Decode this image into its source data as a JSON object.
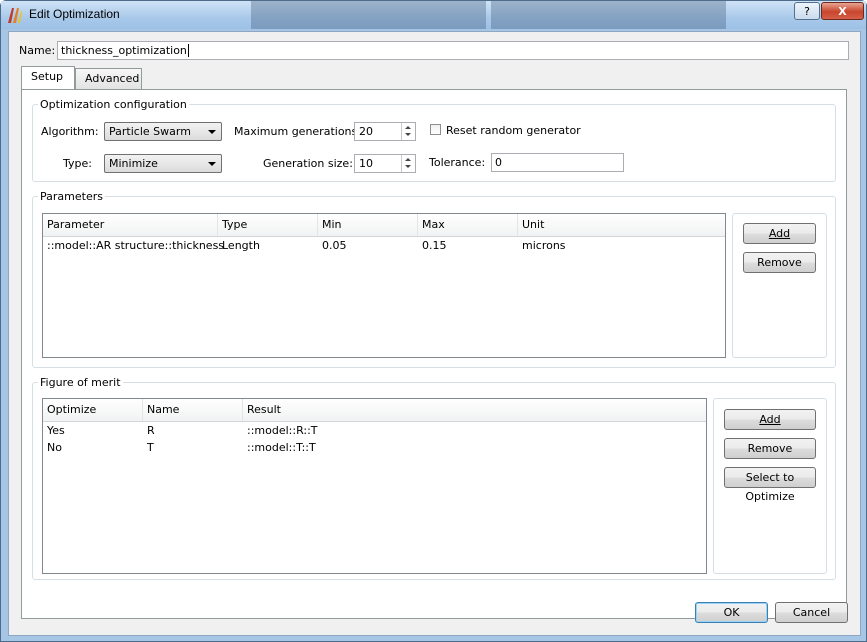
{
  "window": {
    "title": "Edit Optimization",
    "help_label": "?",
    "close_label": "X"
  },
  "name_field": {
    "label": "Name:",
    "value": "thickness_optimization"
  },
  "tabs": [
    {
      "label": "Setup"
    },
    {
      "label": "Advanced"
    }
  ],
  "optimization_config": {
    "title": "Optimization configuration",
    "algorithm_label": "Algorithm:",
    "algorithm_value": "Particle Swarm",
    "type_label": "Type:",
    "type_value": "Minimize",
    "max_generations_label": "Maximum generations:",
    "max_generations_value": "20",
    "generation_size_label": "Generation size:",
    "generation_size_value": "10",
    "reset_random_label": "Reset random generator",
    "tolerance_label": "Tolerance:",
    "tolerance_value": "0"
  },
  "parameters": {
    "title": "Parameters",
    "columns": [
      "Parameter",
      "Type",
      "Min",
      "Max",
      "Unit"
    ],
    "rows": [
      [
        "::model::AR structure::thickness",
        "Length",
        "0.05",
        "0.15",
        "microns"
      ]
    ],
    "add_label": "Add",
    "remove_label": "Remove"
  },
  "figure_of_merit": {
    "title": "Figure of merit",
    "columns": [
      "Optimize",
      "Name",
      "Result"
    ],
    "rows": [
      [
        "Yes",
        "R",
        "::model::R::T"
      ],
      [
        "No",
        "T",
        "::model::T::T"
      ]
    ],
    "add_label": "Add",
    "remove_label": "Remove",
    "select_label": "Select to Optimize"
  },
  "footer": {
    "ok_label": "OK",
    "cancel_label": "Cancel"
  }
}
